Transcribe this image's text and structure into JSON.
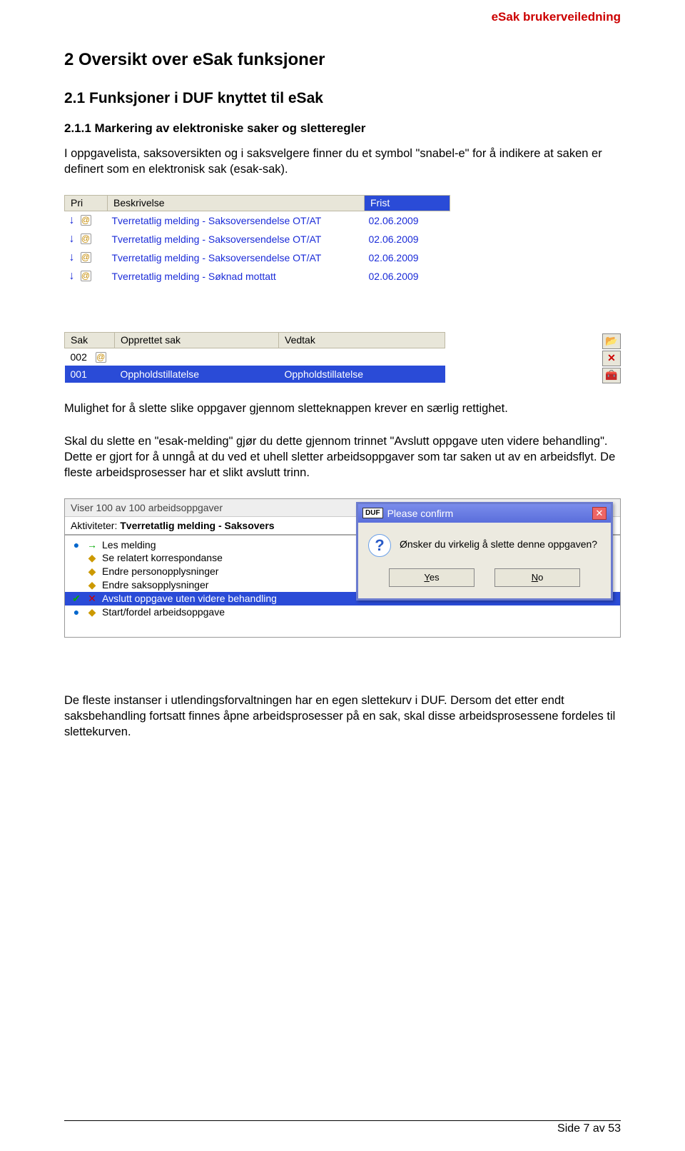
{
  "header_link": "eSak brukerveiledning",
  "h1": "2   Oversikt over eSak funksjoner",
  "h2": "2.1   Funksjoner i DUF knyttet til eSak",
  "h3": "2.1.1   Markering av elektroniske saker og sletteregler",
  "p1": "I oppgavelista, saksoversikten og i saksvelgere finner du et symbol \"snabel-e\" for å indikere at saken er definert som en elektronisk sak (esak-sak).",
  "tbl1": {
    "head": {
      "pri": "Pri",
      "desc": "Beskrivelse",
      "frist": "Frist"
    },
    "rows": [
      {
        "desc": "Tverretatlig melding - Saksoversendelse OT/AT",
        "frist": "02.06.2009"
      },
      {
        "desc": "Tverretatlig melding - Saksoversendelse OT/AT",
        "frist": "02.06.2009"
      },
      {
        "desc": "Tverretatlig melding - Saksoversendelse OT/AT",
        "frist": "02.06.2009"
      },
      {
        "desc": "Tverretatlig melding - Søknad mottatt",
        "frist": "02.06.2009"
      }
    ]
  },
  "tbl2": {
    "head": {
      "sak": "Sak",
      "opp": "Opprettet sak",
      "ved": "Vedtak"
    },
    "rows": [
      {
        "sak": "002",
        "opp": "",
        "ved": "",
        "at": true
      },
      {
        "sak": "001",
        "opp": "Oppholdstillatelse",
        "ved": "Oppholdstillatelse",
        "sel": true
      }
    ]
  },
  "p2a": "Mulighet for å slette slike oppgaver gjennom sletteknappen krever en særlig rettighet.",
  "p2b": "Skal du slette en \"esak-melding\" gjør du dette gjennom trinnet \"Avslutt oppgave uten videre behandling\". Dette er gjort for å unngå at du ved et uhell sletter arbeidsoppgaver som tar saken ut av en arbeidsflyt. De fleste arbeidsprosesser har et slikt avslutt trinn.",
  "shot3": {
    "viser": "Viser 100 av 100 arbeidsoppgaver",
    "akt_label": "Aktiviteter:",
    "akt_value": "Tverretatlig melding - Saksovers",
    "items": [
      "Les melding",
      "Se relatert korrespondanse",
      "Endre personopplysninger",
      "Endre saksopplysninger",
      "Avslutt oppgave uten videre behandling",
      "Start/fordel arbeidsoppgave"
    ],
    "dialog": {
      "title": "Please confirm",
      "question": "Ønsker du virkelig å slette denne oppgaven?",
      "yes": "Yes",
      "no": "No"
    }
  },
  "p3": "De fleste instanser i utlendingsforvaltningen har en egen slettekurv i DUF. Dersom det etter endt saksbehandling fortsatt finnes åpne arbeidsprosesser på en sak, skal disse arbeidsprosessene fordeles til slettekurven.",
  "footer": "Side 7 av 53"
}
